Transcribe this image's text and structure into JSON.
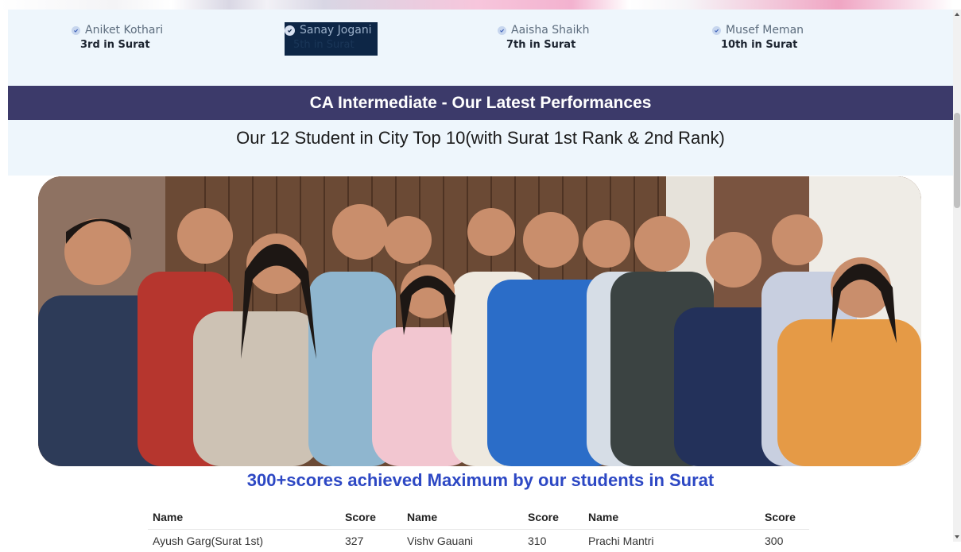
{
  "toppers": [
    {
      "name": "Aniket Kothari",
      "rank": "3rd in Surat"
    },
    {
      "name": "Sanay Jogani",
      "rank": "5th in Surat"
    },
    {
      "name": "Aaisha Shaikh",
      "rank": "7th in Surat"
    },
    {
      "name": "Musef Meman",
      "rank": "10th in Surat"
    }
  ],
  "banner": {
    "title": "CA Intermediate - Our Latest Performances"
  },
  "subtitle": "Our 12 Student in City Top 10(with Surat 1st Rank & 2nd Rank)",
  "photo": {
    "alt": "Group photo of students with faculty"
  },
  "max_heading": "300+scores achieved Maximum by our students in Surat",
  "table": {
    "headers": [
      "Name",
      "Score",
      "Name",
      "Score",
      "Name",
      "Score"
    ],
    "rows": [
      [
        "Ayush Garg(Surat 1st)",
        "327",
        "Vishv Gauani",
        "310",
        "Prachi Mantri",
        "300"
      ]
    ]
  },
  "colors": {
    "banner": "#3c3a6a",
    "heading": "#2d48c4",
    "panel": "#eef6fc"
  }
}
